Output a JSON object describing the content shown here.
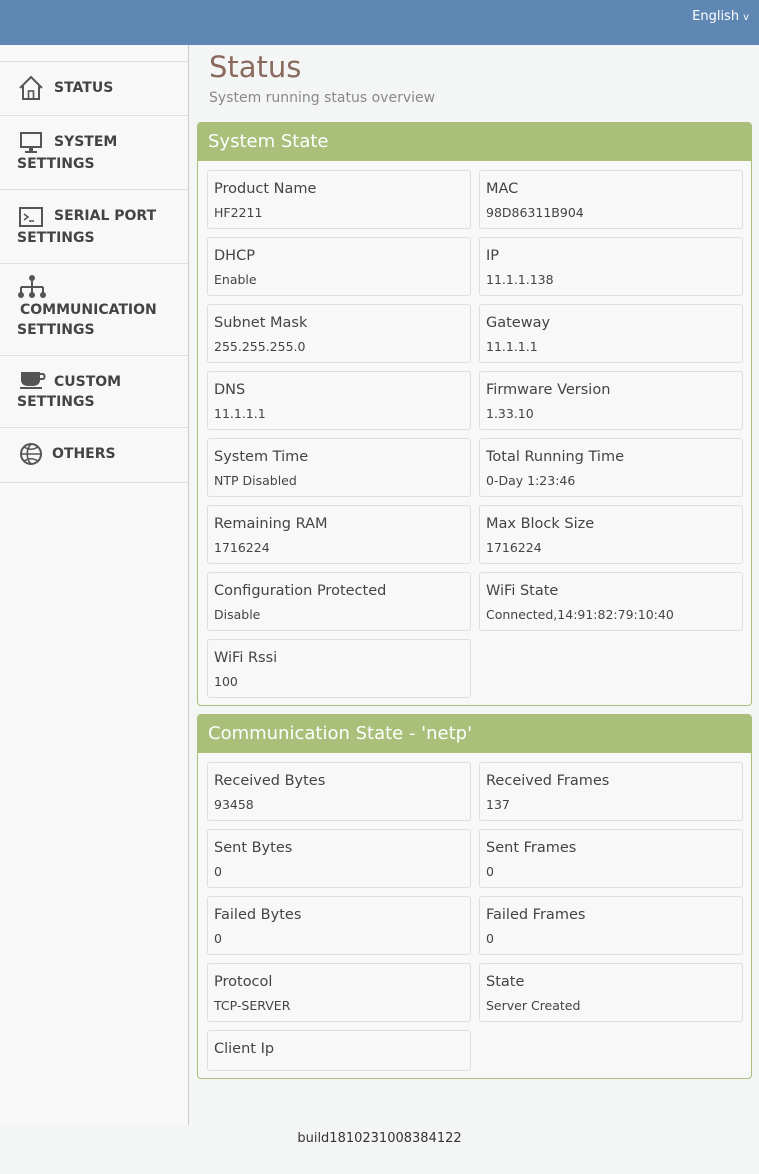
{
  "header": {
    "language": "English",
    "language_chevron": "v"
  },
  "sidebar": {
    "items": [
      {
        "line1": "STATUS",
        "line2": "",
        "icon": "home-icon"
      },
      {
        "line1": "SYSTEM",
        "line2": "SETTINGS",
        "icon": "monitor-icon"
      },
      {
        "line1": "SERIAL PORT",
        "line2": "SETTINGS",
        "icon": "terminal-icon"
      },
      {
        "line1": "COMMUNICATION",
        "line2": "SETTINGS",
        "icon": "network-icon"
      },
      {
        "line1": "CUSTOM",
        "line2": "SETTINGS",
        "icon": "coffee-cup-icon"
      },
      {
        "line1": "OTHERS",
        "line2": "",
        "icon": "basketball-icon"
      }
    ]
  },
  "page": {
    "title": "Status",
    "subtitle": "System running status overview"
  },
  "system_state": {
    "title": "System State",
    "items": [
      {
        "label": "Product Name",
        "value": "HF2211"
      },
      {
        "label": "MAC",
        "value": "98D86311B904"
      },
      {
        "label": "DHCP",
        "value": "Enable"
      },
      {
        "label": "IP",
        "value": "11.1.1.138"
      },
      {
        "label": "Subnet Mask",
        "value": "255.255.255.0"
      },
      {
        "label": "Gateway",
        "value": "11.1.1.1"
      },
      {
        "label": "DNS",
        "value": "11.1.1.1"
      },
      {
        "label": "Firmware Version",
        "value": "1.33.10"
      },
      {
        "label": "System Time",
        "value": "NTP Disabled"
      },
      {
        "label": "Total Running Time",
        "value": "0-Day 1:23:46"
      },
      {
        "label": "Remaining RAM",
        "value": "1716224"
      },
      {
        "label": "Max Block Size",
        "value": "1716224"
      },
      {
        "label": "Configuration Protected",
        "value": "Disable"
      },
      {
        "label": "WiFi State",
        "value": "Connected,14:91:82:79:10:40"
      },
      {
        "label": "WiFi Rssi",
        "value": "100"
      }
    ]
  },
  "comm_state": {
    "title": "Communication State - 'netp'",
    "items": [
      {
        "label": "Received Bytes",
        "value": "93458"
      },
      {
        "label": "Received Frames",
        "value": "137"
      },
      {
        "label": "Sent Bytes",
        "value": "0"
      },
      {
        "label": "Sent Frames",
        "value": "0"
      },
      {
        "label": "Failed Bytes",
        "value": "0"
      },
      {
        "label": "Failed Frames",
        "value": "0"
      },
      {
        "label": "Protocol",
        "value": "TCP-SERVER"
      },
      {
        "label": "State",
        "value": "Server Created"
      },
      {
        "label": "Client Ip",
        "value": ""
      }
    ]
  },
  "footer": {
    "build": "build1810231008384122"
  }
}
